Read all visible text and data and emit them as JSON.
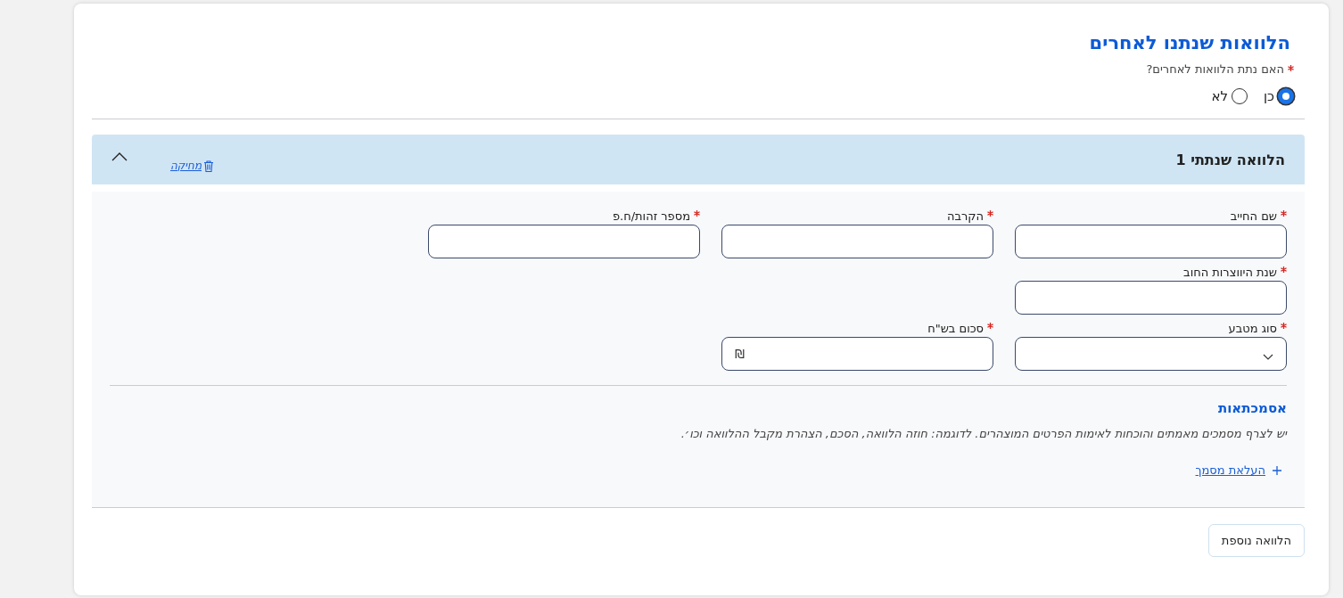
{
  "title": "הלוואות שנתנו לאחרים",
  "question": {
    "label": "האם נתת הלוואות לאחרים?",
    "required": true,
    "options": [
      {
        "label": "כן",
        "selected": true
      },
      {
        "label": "לא",
        "selected": false
      }
    ]
  },
  "loan": {
    "title": "הלוואה שנתתי 1",
    "delete_link": "מחיקה",
    "expanded": true,
    "field_rows": [
      [
        {
          "label": "שם החייב",
          "required": true,
          "kind": "text"
        },
        {
          "label": "הקרבה",
          "required": true,
          "kind": "text"
        },
        {
          "label": "מספר זהות/ח.פ",
          "required": true,
          "kind": "text"
        }
      ],
      [
        {
          "label": "שנת היווצרות החוב",
          "required": true,
          "kind": "text"
        }
      ],
      [
        {
          "label": "סוג מטבע",
          "required": true,
          "kind": "select"
        },
        {
          "label": "סכום בש\"ח",
          "required": true,
          "kind": "currency",
          "symbol": "₪"
        }
      ]
    ],
    "documents": {
      "title": "אסמכתאות",
      "description": "יש לצרף מסמכים מאמתים והוכחות לאימות הפרטים המוצהרים. לדוגמה: חוזה הלוואה, הסכם, הצהרת מקבל ההלוואה וכו׳.",
      "upload_link": "העלאת מסמך"
    }
  },
  "add_button": "הלוואה נוספת"
}
